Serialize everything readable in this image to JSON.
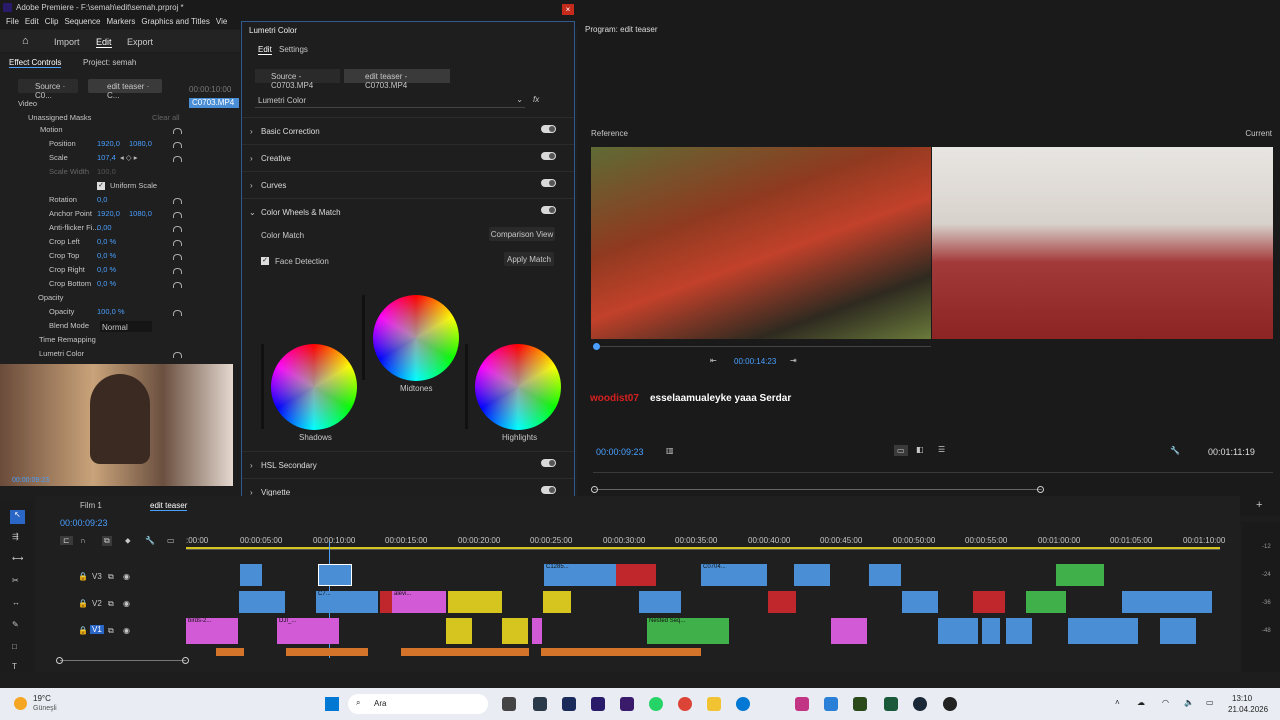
{
  "window": {
    "title": "Adobe Premiere - F:\\semah\\edit\\semah.prproj *"
  },
  "menu": [
    "File",
    "Edit",
    "Clip",
    "Sequence",
    "Markers",
    "Graphics and Titles",
    "Vie"
  ],
  "workspace": {
    "import": "Import",
    "edit": "Edit",
    "export": "Export"
  },
  "effect_controls": {
    "tab": "Effect Controls",
    "project_tab": "Project: semah",
    "source_tab": "Source · C0...",
    "seq_tab": "edit teaser · C...",
    "timecode": "00:00:10:00",
    "clip_label": "C0703.MP4",
    "video": "Video",
    "masks": "Unassigned Masks",
    "clear_all": "Clear all",
    "motion": "Motion",
    "position": "Position",
    "position_x": "1920,0",
    "position_y": "1080,0",
    "scale": "Scale",
    "scale_val": "107,4",
    "scale_width": "Scale Width",
    "scale_width_val": "100,0",
    "uniform": "Uniform Scale",
    "rotation": "Rotation",
    "rotation_val": "0,0",
    "anchor": "Anchor Point",
    "anchor_x": "1920,0",
    "anchor_y": "1080,0",
    "antiflicker": "Anti-flicker Fi...",
    "antiflicker_val": "0,00",
    "crop_left": "Crop Left",
    "crop_left_val": "0,0 %",
    "crop_top": "Crop Top",
    "crop_top_val": "0,0 %",
    "crop_right": "Crop Right",
    "crop_right_val": "0,0 %",
    "crop_bottom": "Crop Bottom",
    "crop_bottom_val": "0,0 %",
    "opacity_group": "Opacity",
    "opacity": "Opacity",
    "opacity_val": "100,0 %",
    "blend": "Blend Mode",
    "blend_val": "Normal",
    "time_remap": "Time Remapping",
    "lumetri": "Lumetri Color",
    "webcam_time": "00:00:09:23"
  },
  "lumetri": {
    "title": "Lumetri Color",
    "tab_edit": "Edit",
    "tab_settings": "Settings",
    "source": "Source - C0703.MP4",
    "seq": "edit teaser - C0703.MP4",
    "effect": "Lumetri Color",
    "sections": [
      "Basic Correction",
      "Creative",
      "Curves",
      "Color Wheels & Match"
    ],
    "color_match": "Color Match",
    "comparison": "Comparison View",
    "face": "Face Detection",
    "apply": "Apply Match",
    "shadows": "Shadows",
    "midtones": "Midtones",
    "highlights": "Highlights",
    "hsl": "HSL Secondary",
    "vignette": "Vignette"
  },
  "program": {
    "title": "Program: edit teaser",
    "reference": "Reference",
    "current": "Current",
    "ref_time": "00:00:14:23",
    "chat_user": "woodist07",
    "chat_msg": "esselaamualeyke yaaa Serdar",
    "timecode": "00:00:09:23",
    "duration": "00:01:11:19"
  },
  "timeline": {
    "tab1": "Film 1",
    "tab2": "edit teaser",
    "timecode": "00:00:09:23",
    "ruler": [
      ":00:00",
      "00:00:05:00",
      "00:00:10:00",
      "00:00:15:00",
      "00:00:20:00",
      "00:00:25:00",
      "00:00:30:00",
      "00:00:35:00",
      "00:00:40:00",
      "00:00:45:00",
      "00:00:50:00",
      "00:00:55:00",
      "00:01:00:00",
      "00:01:05:00",
      "00:01:10:00"
    ],
    "tracks": [
      "V3",
      "V2",
      "V1"
    ],
    "clip_labels": {
      "c1285": "C1285...",
      "c7": "C7...",
      "c0704": "C0704...",
      "birds": "birds-2...",
      "dji": "DJI_...",
      "nested": "Nested Seq...",
      "alevi": "alevi..."
    },
    "meter": [
      "-12",
      "-24",
      "-36",
      "-48"
    ]
  },
  "taskbar": {
    "temp": "19°C",
    "weather": "Güneşli",
    "search": "Ara",
    "time": "13:10",
    "date": "21.04.2026"
  }
}
